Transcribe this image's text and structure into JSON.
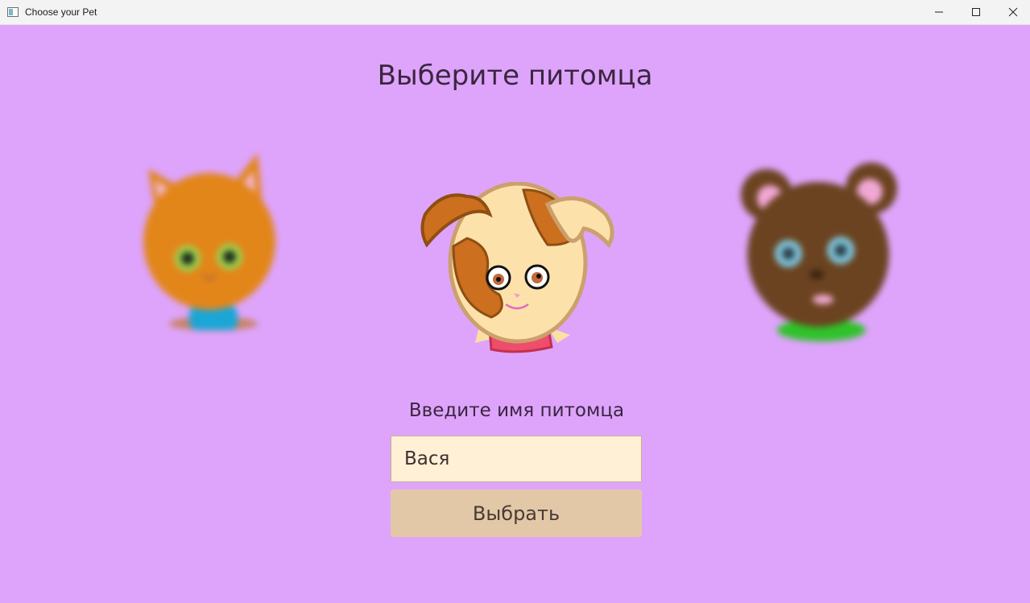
{
  "window": {
    "title": "Choose your Pet",
    "background": "#dea4fb"
  },
  "controls": {
    "minimize_icon": "minimize-icon",
    "maximize_icon": "maximize-icon",
    "close_icon": "close-icon"
  },
  "main": {
    "heading": "Выберите питомца",
    "pets": [
      {
        "name": "cat",
        "selected": false
      },
      {
        "name": "dog",
        "selected": true
      },
      {
        "name": "bear",
        "selected": false
      }
    ],
    "name_label": "Введите имя питомца",
    "name_value": "Вася",
    "select_label": "Выбрать"
  }
}
